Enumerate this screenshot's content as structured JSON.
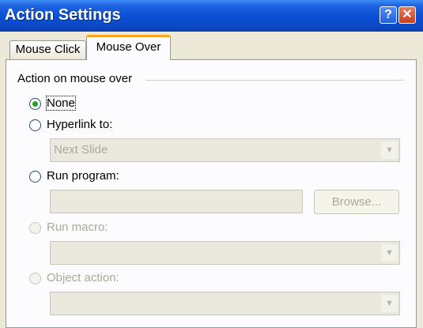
{
  "dialog": {
    "title": "Action Settings",
    "help_button": "?",
    "close_button": "✕"
  },
  "tabs": [
    {
      "label": "Mouse Click",
      "selected": false
    },
    {
      "label": "Mouse Over",
      "selected": true
    }
  ],
  "group": {
    "label": "Action on mouse over"
  },
  "options": {
    "none": {
      "label": "None",
      "checked": true
    },
    "hyperlink": {
      "label": "Hyperlink to:",
      "checked": false,
      "value": "Next Slide",
      "dropdown_icon": "chevron-down-icon"
    },
    "run_program": {
      "label": "Run program:",
      "checked": false,
      "value": "",
      "browse_label": "Browse..."
    },
    "run_macro": {
      "label": "Run macro:",
      "checked": false,
      "enabled": false,
      "value": ""
    },
    "object_action": {
      "label": "Object action:",
      "checked": false,
      "enabled": false,
      "value": ""
    }
  },
  "colors": {
    "titlebar": "#0a4fd4",
    "active_tab_accent": "#f5a623",
    "radio_dot": "#21a121",
    "disabled_text": "#aca899"
  }
}
